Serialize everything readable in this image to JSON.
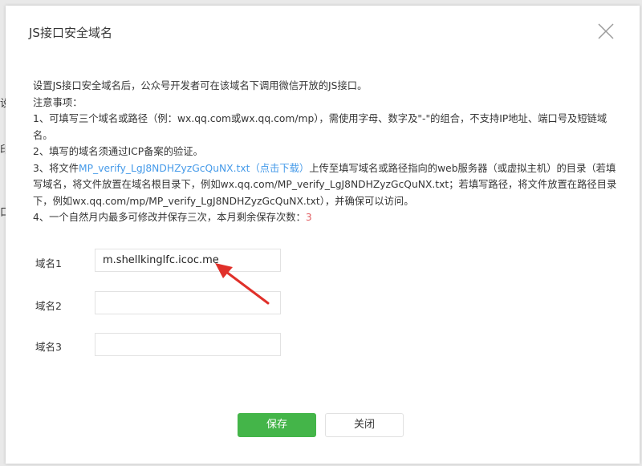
{
  "background": {
    "fragments": [
      "设",
      "印",
      "口"
    ]
  },
  "dialog": {
    "title": "JS接口安全域名",
    "close_icon": "close-icon",
    "intro": "设置JS接口安全域名后，公众号开发者可在该域名下调用微信开放的JS接口。",
    "notes_heading": "注意事项：",
    "note1": "1、可填写三个域名或路径（例：wx.qq.com或wx.qq.com/mp），需使用字母、数字及\"-\"的组合，不支持IP地址、端口号及短链域名。",
    "note2": "2、填写的域名须通过ICP备案的验证。",
    "note3": {
      "prefix": "3、将文件",
      "file_link": "MP_verify_LgJ8NDHZyzGcQuNX.txt",
      "download_link": "（点击下载）",
      "suffix": "上传至填写域名或路径指向的web服务器（或虚拟主机）的目录（若填写域名，将文件放置在域名根目录下，例如wx.qq.com/MP_verify_LgJ8NDHZyzGcQuNX.txt；若填写路径，将文件放置在路径目录下，例如wx.qq.com/mp/MP_verify_LgJ8NDHZyzGcQuNX.txt），并确保可以访问。"
    },
    "note4": {
      "text": "4、一个自然月内最多可修改并保存三次，本月剩余保存次数：",
      "remaining": "3"
    },
    "fields": [
      {
        "label": "域名1",
        "value": "m.shellkinglfc.icoc.me"
      },
      {
        "label": "域名2",
        "value": ""
      },
      {
        "label": "域名3",
        "value": ""
      }
    ],
    "save_label": "保存",
    "close_label": "关闭"
  },
  "colors": {
    "accent_green": "#44b549",
    "link_blue": "#459ae9",
    "count_red": "#e15f63",
    "annotation_red": "#e0302a"
  }
}
